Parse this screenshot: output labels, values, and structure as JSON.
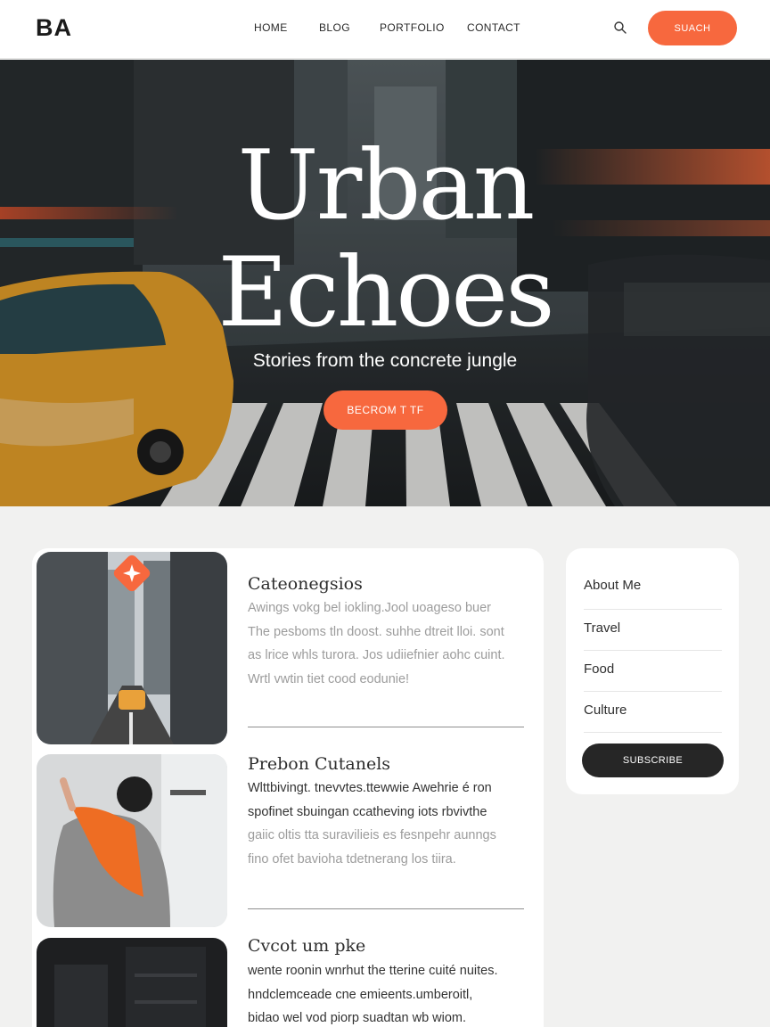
{
  "header": {
    "logo": "BA",
    "nav": [
      "HOME",
      "BLOG",
      "PORTFOLIO",
      "CONTACT"
    ],
    "search_icon": "search-icon",
    "cta_label": "SUACH"
  },
  "hero": {
    "title_line1": "Urban",
    "title_line2": "Echoes",
    "subtitle": "Stories from the concrete jungle",
    "button_label": "BECROM T TF"
  },
  "posts": [
    {
      "title": "Cateonegsios",
      "lines": [
        "Awings vokg bel iokling.Jool uoageso buer",
        "The pesboms tln doost. suhhe dtreit lloi. sont",
        "as lrice whls turora. Jos udiiefnier aohc cuint.",
        "Wrtl vwtin tiet cood eodunie!"
      ]
    },
    {
      "title": "Prebon Cutanels",
      "lines": [
        "Wlttbivingt. tnevvtes.ttewwie Awehrie é ron",
        "spofinet sbuingan ccatheving iots rbvivthe",
        "gaiic oltis tta suravilieis es fesnpehr aunngs",
        "fino ofet bavioha tdetnerang los tiira."
      ]
    },
    {
      "title": "Cvcot um pke",
      "lines": [
        "wente roonin wnrhut the tterine cuité nuites.",
        "hndclemceade cne emieents.umberoitl,",
        "bidao wel vod piorp suadtan wb wiom."
      ]
    }
  ],
  "post_badge_icon": "sparkle-icon",
  "sidebar": {
    "items": [
      "About Me",
      "Travel",
      "Food",
      "Culture"
    ],
    "button_label": "SUBSCRIBE"
  },
  "colors": {
    "accent": "#f7683e",
    "dark_button": "#262626",
    "page_background": "#f1f1f0"
  }
}
